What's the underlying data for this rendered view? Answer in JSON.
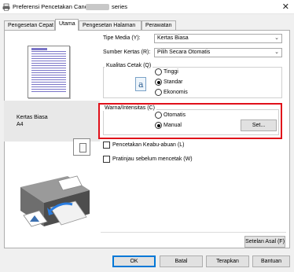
{
  "window": {
    "title": "Preferensi Pencetakan Canon",
    "title_suffix": "series",
    "close_label": "✕"
  },
  "tabs": [
    {
      "label": "Pengesetan Cepat",
      "active": false
    },
    {
      "label": "Utama",
      "active": true
    },
    {
      "label": "Pengesetan Halaman",
      "active": false
    },
    {
      "label": "Perawatan",
      "active": false
    }
  ],
  "preview": {
    "paper_name": "Kertas Biasa",
    "paper_size": "A4"
  },
  "media_type": {
    "label": "Tipe Media (Y):",
    "value": "Kertas Biasa"
  },
  "paper_source": {
    "label": "Sumber Kertas (R):",
    "value": "Pilih Secara Otomatis"
  },
  "print_quality": {
    "title": "Kualitas Cetak (Q)",
    "icon_glyph": "a",
    "options": [
      {
        "label": "Tinggi",
        "selected": false
      },
      {
        "label": "Standar",
        "selected": true
      },
      {
        "label": "Ekonomis",
        "selected": false
      }
    ]
  },
  "color_intensity": {
    "title": "Warna/Intensitas (C)",
    "options": [
      {
        "label": "Otomatis",
        "selected": false
      },
      {
        "label": "Manual",
        "selected": true
      }
    ],
    "set_button": "Set..."
  },
  "grayscale": {
    "label": "Pencetakan Keabu-abuan (L)",
    "checked": false
  },
  "print_preview": {
    "label": "Pratinjau sebelum mencetak (W)",
    "checked": false
  },
  "defaults_button": "Setelan Asal (F)",
  "footer": {
    "ok": "OK",
    "cancel": "Batal",
    "apply": "Terapkan",
    "help": "Bantuan"
  },
  "colors": {
    "highlight": "#e0101a",
    "default_button_border": "#0078d7"
  }
}
